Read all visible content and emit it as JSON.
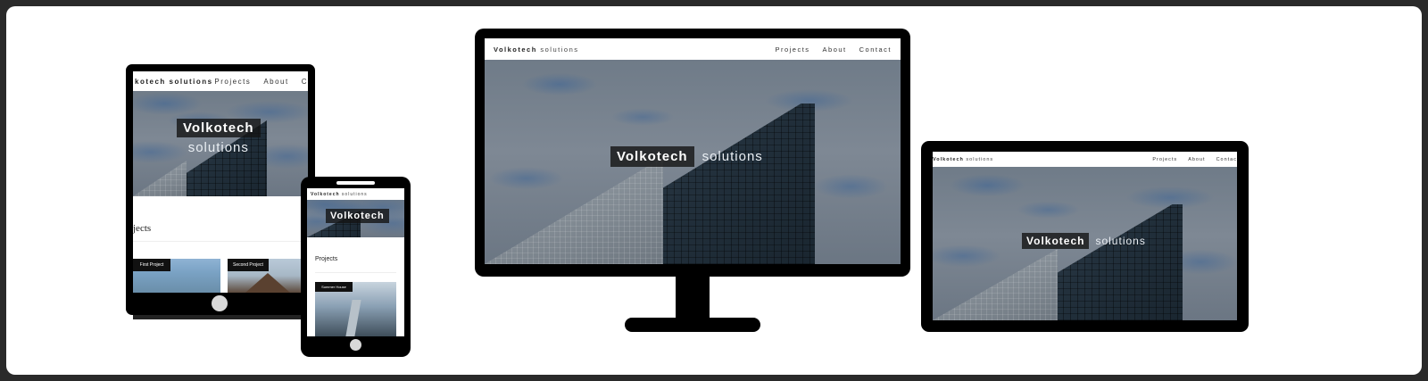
{
  "brand": {
    "name_bold": "Volkotech",
    "name_light": "solutions"
  },
  "nav": {
    "projects": "Projects",
    "about": "About",
    "contact": "Contact"
  },
  "hero": {
    "title_bold": "Volkotech",
    "title_light": "solutions"
  },
  "tablet_portrait": {
    "nav_brand": "kotech solutions",
    "nav_projects": "Projects",
    "nav_about": "About",
    "nav_contact": "C",
    "section_title": "jects",
    "thumb_1_label": "First Project",
    "thumb_2_label": "Second Project"
  },
  "phone": {
    "nav_brand_bold": "Volkotech",
    "nav_brand_light": "solutions",
    "hero_title": "Volkotech",
    "section_title": "Projects",
    "thumb_label": "Summer House"
  },
  "tablet_landscape": {
    "nav_contact": "Contac"
  }
}
